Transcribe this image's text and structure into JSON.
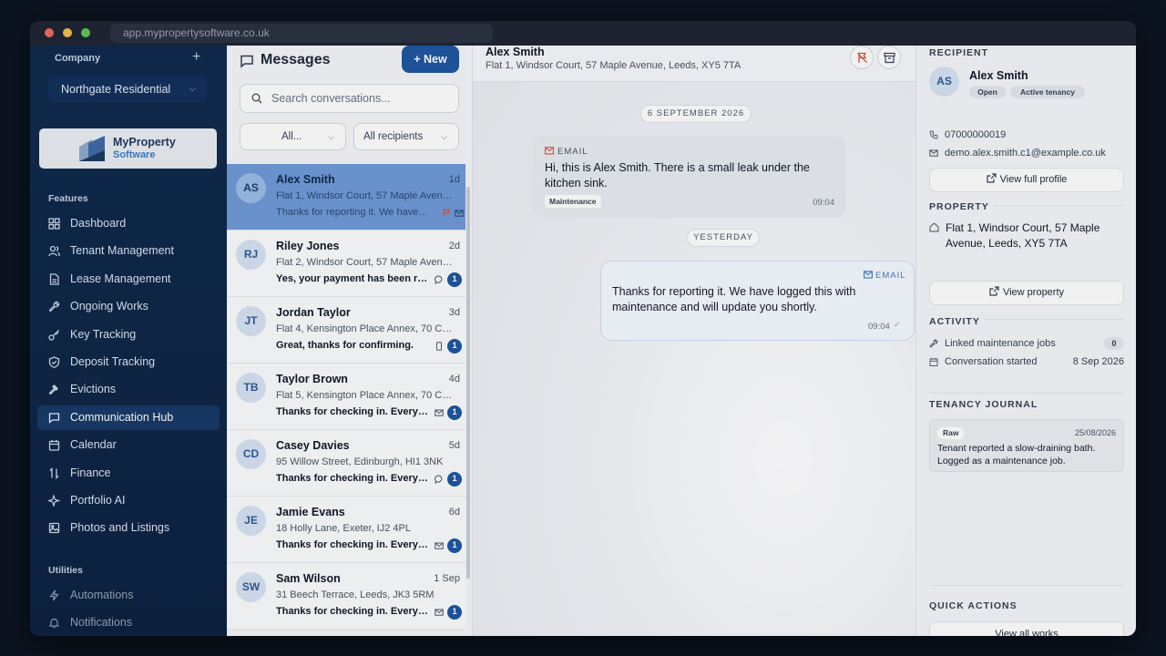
{
  "browser": {
    "url": "app.mypropertysoftware.co.uk"
  },
  "sidebar": {
    "company_label": "Company",
    "company_add": "+",
    "company_value": "Northgate Residential",
    "logo": {
      "line1": "MyProperty",
      "line2": "Software"
    },
    "features_label": "Features",
    "features": [
      {
        "label": "Dashboard",
        "icon": "grid-icon"
      },
      {
        "label": "Tenant Management",
        "icon": "users-icon"
      },
      {
        "label": "Lease Management",
        "icon": "file-icon"
      },
      {
        "label": "Ongoing Works",
        "icon": "wrench-icon"
      },
      {
        "label": "Key Tracking",
        "icon": "key-icon"
      },
      {
        "label": "Deposit Tracking",
        "icon": "shield-icon"
      },
      {
        "label": "Evictions",
        "icon": "gavel-icon"
      },
      {
        "label": "Communication Hub",
        "icon": "message-icon",
        "active": true
      },
      {
        "label": "Calendar",
        "icon": "calendar-icon"
      },
      {
        "label": "Finance",
        "icon": "arrows-icon"
      },
      {
        "label": "Portfolio AI",
        "icon": "sparkle-icon"
      },
      {
        "label": "Photos and Listings",
        "icon": "image-icon"
      }
    ],
    "utilities_label": "Utilities",
    "utilities": [
      {
        "label": "Automations",
        "icon": "bolt-icon"
      },
      {
        "label": "Notifications",
        "icon": "bell-icon"
      }
    ]
  },
  "messages": {
    "title": "Messages",
    "new_label": "+ New",
    "search_placeholder": "Search conversations...",
    "filter_status": "All...",
    "filter_recipients": "All recipients",
    "conversations": [
      {
        "initials": "AS",
        "name": "Alex Smith",
        "time": "1d",
        "address": "Flat 1, Windsor Court, 57 Maple Avenue, ...",
        "preview": "Thanks for reporting it. We have lo...",
        "channel": "email",
        "flagged": true,
        "unread": ""
      },
      {
        "initials": "RJ",
        "name": "Riley Jones",
        "time": "2d",
        "address": "Flat 2, Windsor Court, 57 Maple Avenue, ...",
        "preview": "Yes, your payment has been rec...",
        "channel": "chat",
        "unread": "1"
      },
      {
        "initials": "JT",
        "name": "Jordan Taylor",
        "time": "3d",
        "address": "Flat 4, Kensington Place Annex, 70 Cedar...",
        "preview": "Great, thanks for confirming.",
        "channel": "sms",
        "unread": "1"
      },
      {
        "initials": "TB",
        "name": "Taylor Brown",
        "time": "4d",
        "address": "Flat 5, Kensington Place Annex, 70 Cedar...",
        "preview": "Thanks for checking in. Everythi...",
        "channel": "email",
        "unread": "1"
      },
      {
        "initials": "CD",
        "name": "Casey Davies",
        "time": "5d",
        "address": "95 Willow Street, Edinburgh, HI1 3NK",
        "preview": "Thanks for checking in. Everythi...",
        "channel": "chat",
        "unread": "1"
      },
      {
        "initials": "JE",
        "name": "Jamie Evans",
        "time": "6d",
        "address": "18 Holly Lane, Exeter, IJ2 4PL",
        "preview": "Thanks for checking in. Everythi...",
        "channel": "email",
        "unread": "1"
      },
      {
        "initials": "SW",
        "name": "Sam Wilson",
        "time": "1 Sep",
        "address": "31 Beech Terrace, Leeds, JK3 5RM",
        "preview": "Thanks for checking in. Everythi...",
        "channel": "email",
        "unread": "1"
      }
    ]
  },
  "thread": {
    "name": "Alex Smith",
    "address": "Flat 1, Windsor Court, 57 Maple Avenue, Leeds, XY5 7TA",
    "date_pill_1": "6 SEPTEMBER 2026",
    "date_pill_2": "YESTERDAY",
    "inbound": {
      "channel": "EMAIL",
      "text": "Hi, this is Alex Smith. There is a small leak under the kitchen sink.",
      "tag": "Maintenance",
      "time": "09:04"
    },
    "outbound": {
      "channel": "EMAIL",
      "text": "Thanks for reporting it. We have logged this with maintenance and will update you shortly.",
      "time": "09:04"
    }
  },
  "recipient": {
    "section": "RECIPIENT",
    "initials": "AS",
    "name": "Alex Smith",
    "status": "Open",
    "tenancy": "Active tenancy",
    "phone": "07000000019",
    "email": "demo.alex.smith.c1@example.co.uk",
    "profile_btn": "View full profile"
  },
  "property": {
    "section": "PROPERTY",
    "address": "Flat 1, Windsor Court, 57 Maple Avenue, Leeds, XY5 7TA",
    "view_btn": "View property"
  },
  "activity": {
    "section": "ACTIVITY",
    "jobs_label": "Linked maintenance jobs",
    "jobs_count": "0",
    "started_label": "Conversation started",
    "started_value": "8 Sep 2026"
  },
  "journal": {
    "section": "TENANCY JOURNAL",
    "tag": "Raw",
    "date": "25/08/2026",
    "text": "Tenant reported a slow-draining bath. Logged as a maintenance job."
  },
  "quick_actions": {
    "section": "QUICK ACTIONS",
    "first_btn": "View all works"
  },
  "colors": {
    "accent": "#1e56a0",
    "sidebar": "#0f2a4d",
    "selected_row": "#6f9ad6",
    "flag": "#e0533d"
  }
}
